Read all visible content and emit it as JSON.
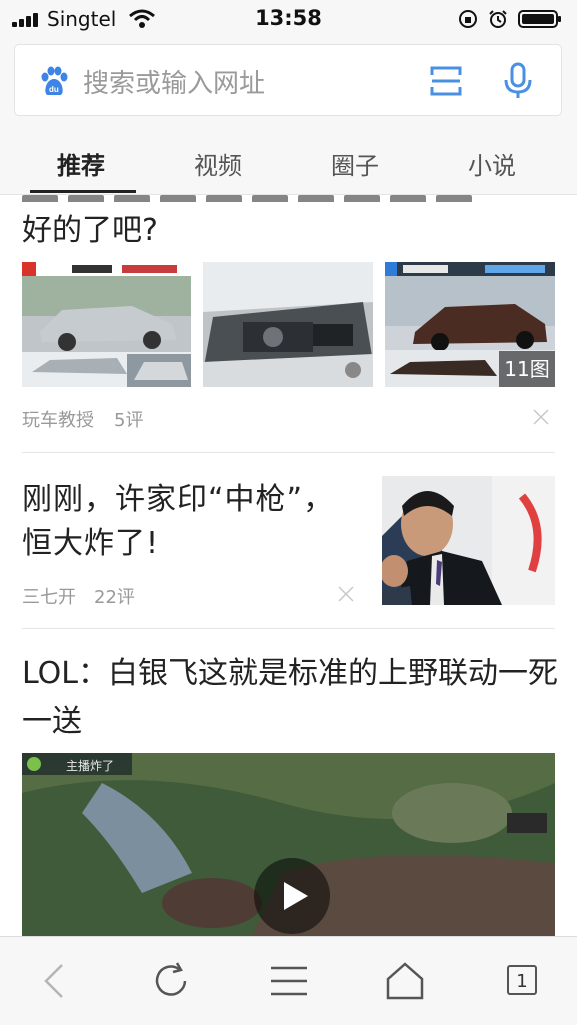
{
  "status_bar": {
    "carrier": "Singtel",
    "time": "13:58"
  },
  "search": {
    "placeholder": "搜索或输入网址"
  },
  "tabs": [
    {
      "label": "推荐",
      "active": true
    },
    {
      "label": "视频"
    },
    {
      "label": "圈子"
    },
    {
      "label": "小说"
    }
  ],
  "feed": {
    "article1": {
      "title": "好的了吧?",
      "image_count": "11图",
      "source": "玩车教授",
      "comments": "5评"
    },
    "article2": {
      "title": "刚刚，许家印“中枪”，恒大炸了!",
      "source": "三七开",
      "comments": "22评"
    },
    "article3": {
      "title": "LOL：白银飞这就是标准的上野联动一死一送",
      "video_caption": "主播炸了"
    }
  },
  "bottom_bar": {
    "tab_count": "1"
  },
  "colors": {
    "accent": "#4a90e2",
    "text": "#222222",
    "meta": "#999999"
  }
}
